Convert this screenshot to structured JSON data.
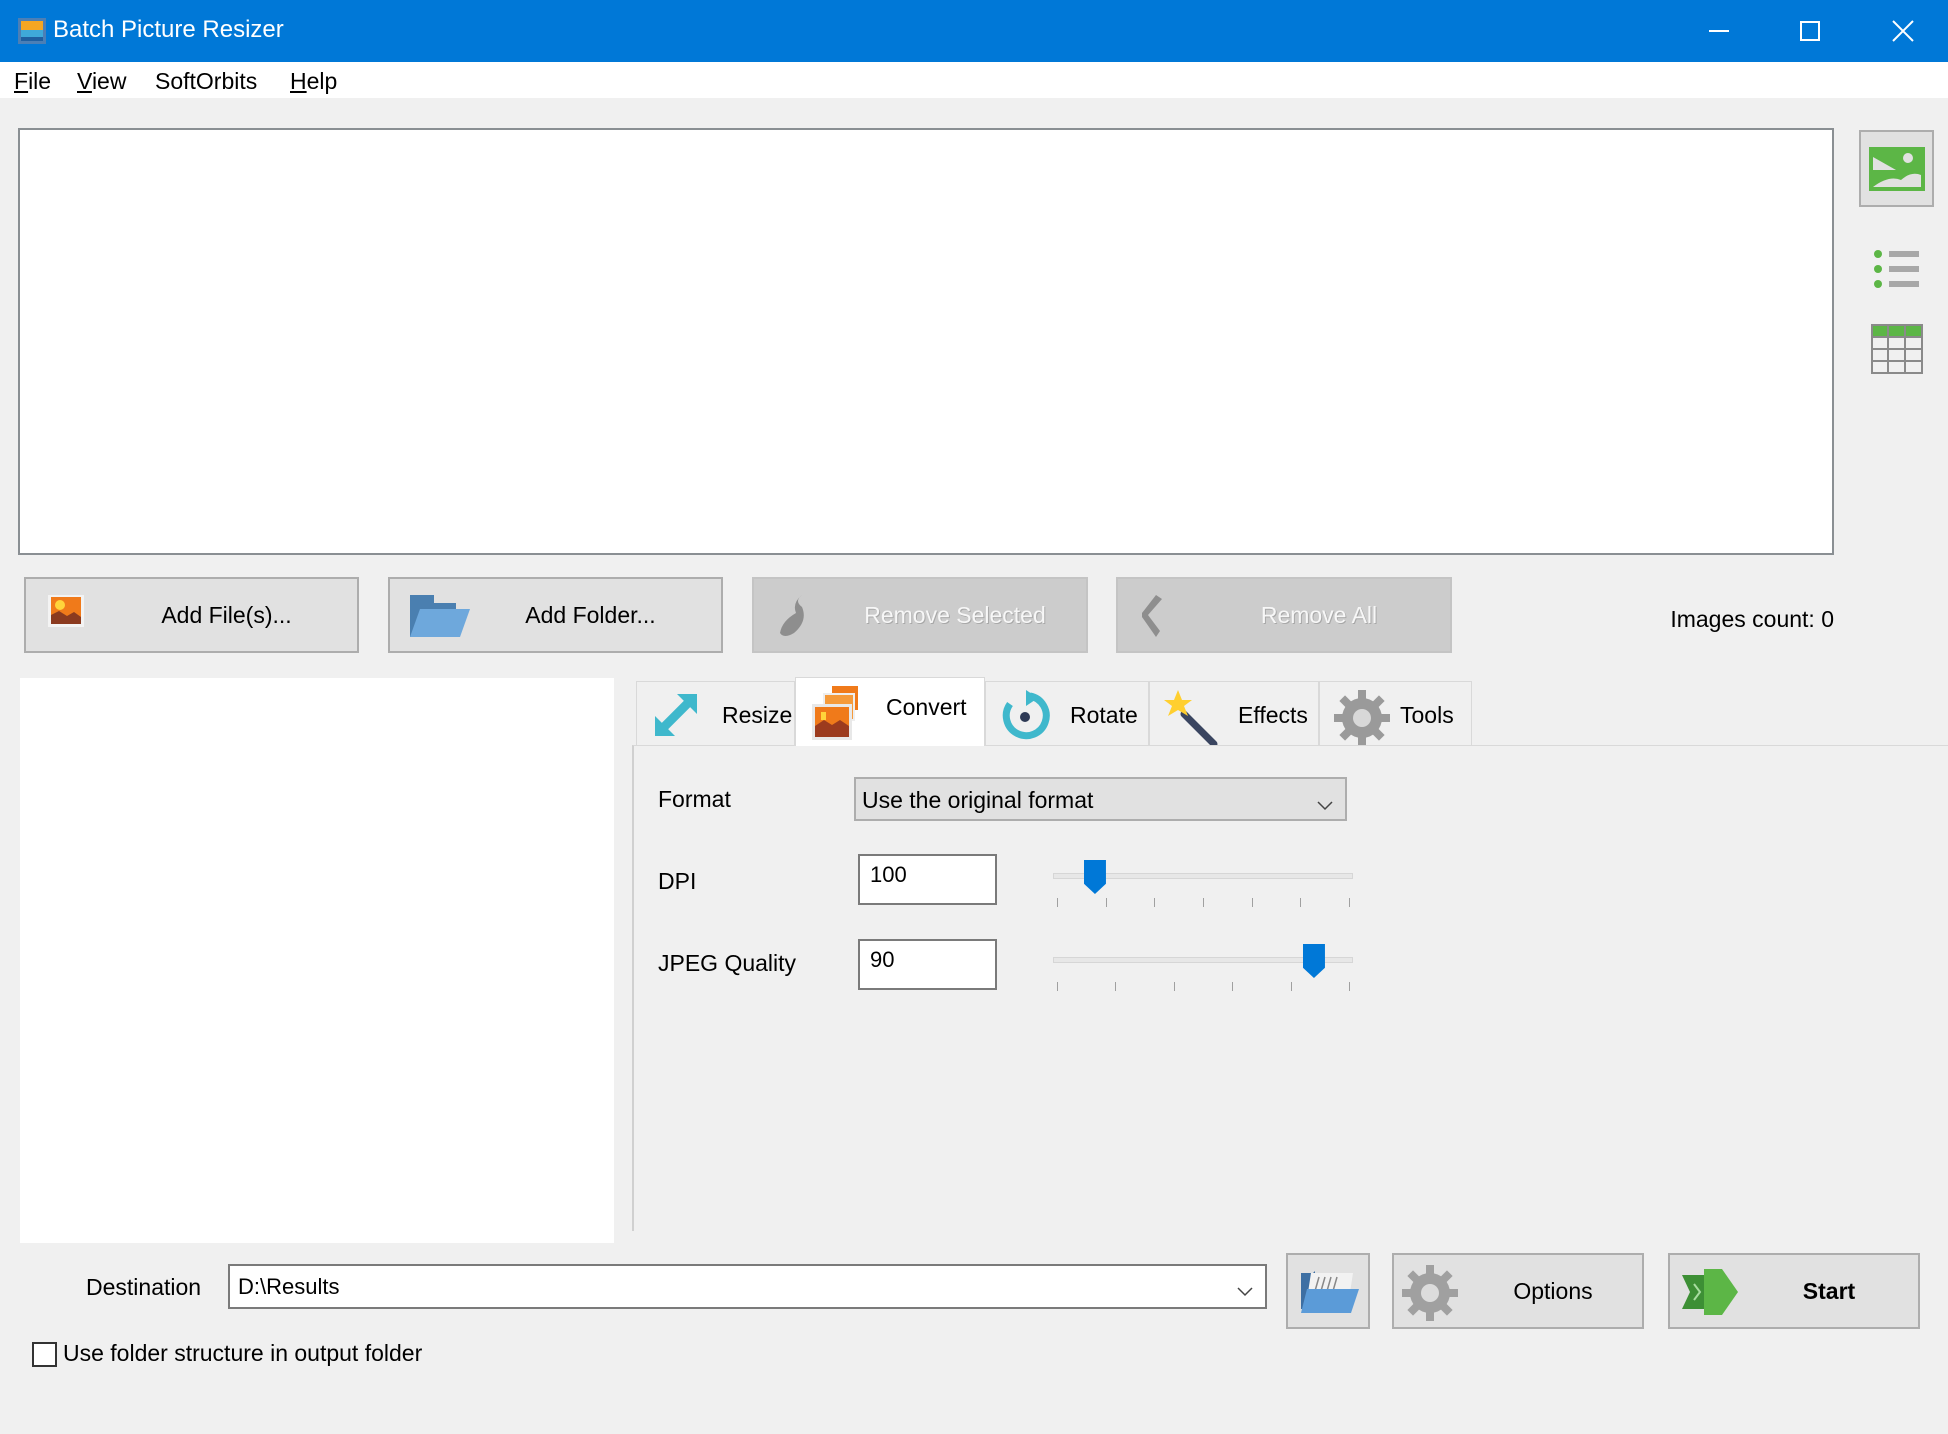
{
  "window": {
    "title": "Batch Picture Resizer",
    "controls": {
      "minimize": "minimize-icon",
      "maximize": "maximize-icon",
      "close": "close-icon"
    }
  },
  "menu": [
    {
      "label": "File",
      "accel": "F",
      "rest": "ile"
    },
    {
      "label": "View",
      "accel": "V",
      "rest": "iew"
    },
    {
      "label": "SoftOrbits",
      "accel": "",
      "rest": "SoftOrbits"
    },
    {
      "label": "Help",
      "accel": "H",
      "rest": "elp"
    }
  ],
  "view_modes": [
    "thumbnails-view-icon",
    "list-view-icon",
    "table-view-icon"
  ],
  "file_buttons": {
    "add_files": "Add File(s)...",
    "add_folder": "Add Folder...",
    "remove_selected": "Remove Selected",
    "remove_all": "Remove All"
  },
  "images_count": "Images count: 0",
  "tabs": [
    {
      "label": "Resize",
      "icon": "resize-arrows-icon",
      "active": false
    },
    {
      "label": "Convert",
      "icon": "convert-images-icon",
      "active": true
    },
    {
      "label": "Rotate",
      "icon": "rotate-icon",
      "active": false
    },
    {
      "label": "Effects",
      "icon": "magic-wand-icon",
      "active": false
    },
    {
      "label": "Tools",
      "icon": "gear-icon",
      "active": false
    }
  ],
  "convert": {
    "format_label": "Format",
    "format_value": "Use the original format",
    "dpi_label": "DPI",
    "dpi_value": "100",
    "dpi_slider_fraction": 0.13,
    "dpi_ticks": 7,
    "jpeg_label": "JPEG Quality",
    "jpeg_value": "90",
    "jpeg_slider_fraction": 0.88,
    "jpeg_ticks": 6
  },
  "destination": {
    "label": "Destination",
    "value": "D:\\Results"
  },
  "actions": {
    "options": "Options",
    "start": "Start"
  },
  "folder_structure": {
    "label": "Use folder structure in output folder",
    "checked": false
  },
  "colors": {
    "accent": "#0078d7",
    "green": "#5cb646"
  }
}
